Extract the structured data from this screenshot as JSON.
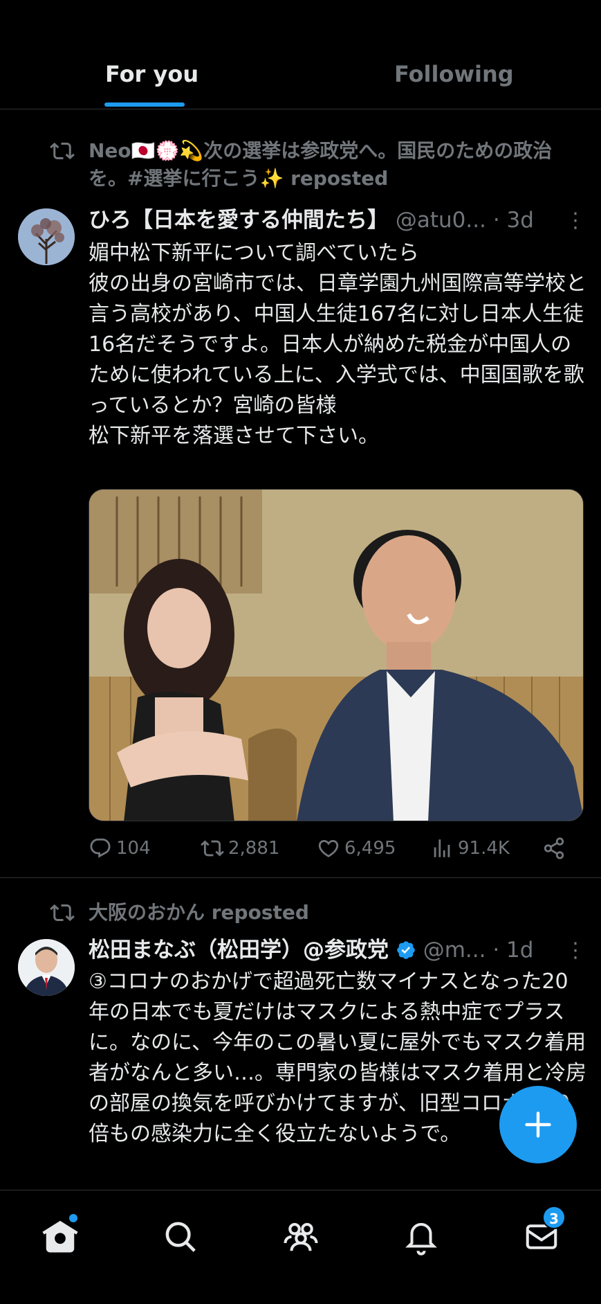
{
  "tabs": {
    "for_you": "For you",
    "following": "Following"
  },
  "tweets": [
    {
      "repost_by": "Neo🇯🇵💮💫次の選挙は参政党へ。国民のための政治を。#選挙に行こう✨ reposted",
      "author_name": "ひろ【日本を愛する仲間たち】",
      "handle": "@atu0...",
      "time": "· 3d",
      "text": "媚中松下新平について調べていたら\n彼の出身の宮崎市では、日章学園九州国際高等学校と言う高校があり、中国人生徒167名に対し日本人生徒16名だそうですよ。日本人が納めた税金が中国人のために使われている上に、入学式では、中国国歌を歌っているとか？宮崎の皆様\n松下新平を落選させて下さい。",
      "replies": "104",
      "retweets": "2,881",
      "likes": "6,495",
      "views": "91.4K"
    },
    {
      "repost_by": "大阪のおかん reposted",
      "author_name": "松田まなぶ（松田学）@参政党",
      "handle": "@m...",
      "time": "· 1d",
      "text": "③コロナのおかげで超過死亡数マイナスとなった20年の日本でも夏だけはマスクによる熱中症でプラスに。なのに、今年のこの暑い夏に屋外でもマスク着用者がなんと多い…。専門家の皆様はマスク着用と冷房の部屋の換気を呼びかけてますが、旧型コロナの70倍もの感染力に全く役立たないようで。"
    }
  ],
  "nav": {
    "messages_badge": "3"
  },
  "colors": {
    "accent": "#1d9bf0",
    "background": "#000000",
    "muted": "#71767b",
    "text": "#e7e9ea"
  }
}
